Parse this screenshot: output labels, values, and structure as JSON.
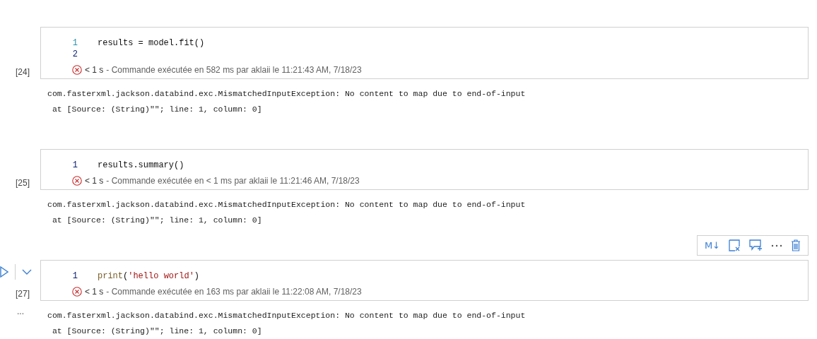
{
  "cells": [
    {
      "prompt": "[24]",
      "lines": [
        {
          "number": "1",
          "current": false,
          "tokens": [
            {
              "text": "results = model.fit()",
              "kind": "plain"
            }
          ]
        },
        {
          "number": "2",
          "current": true
        }
      ],
      "status": {
        "error": true,
        "duration": "< 1 s",
        "message": "- Commande exécutée en 582 ms par aklaii le 11:21:43 AM, 7/18/23"
      },
      "output": [
        "com.fasterxml.jackson.databind.exc.MismatchedInputException: No content to map due to end-of-input",
        " at [Source: (String)\"\"; line: 1, column: 0]"
      ]
    },
    {
      "prompt": "[25]",
      "lines": [
        {
          "number": "1",
          "current": true,
          "tokens": [
            {
              "text": "results.summary()",
              "kind": "plain"
            }
          ]
        }
      ],
      "status": {
        "error": true,
        "duration": "< 1 s",
        "message": "- Commande exécutée en < 1 ms par aklaii le 11:21:46 AM, 7/18/23"
      },
      "output": [
        "com.fasterxml.jackson.databind.exc.MismatchedInputException: No content to map due to end-of-input",
        " at [Source: (String)\"\"; line: 1, column: 0]"
      ]
    },
    {
      "prompt": "[27]",
      "more": "...",
      "toolbar": [
        {
          "kind": "markdown",
          "label": "M↓"
        },
        {
          "kind": "clear-output"
        },
        {
          "kind": "comment"
        },
        {
          "kind": "more"
        },
        {
          "kind": "delete"
        }
      ],
      "lines": [
        {
          "number": "1",
          "current": true,
          "tokens": [
            {
              "text": "print",
              "kind": "function"
            },
            {
              "text": "(",
              "kind": "plain"
            },
            {
              "text": "'hello world'",
              "kind": "string"
            },
            {
              "text": ")",
              "kind": "plain"
            }
          ]
        }
      ],
      "status": {
        "error": true,
        "duration": "< 1 s",
        "message": "- Commande exécutée en 163 ms par aklaii le 11:22:08 AM, 7/18/23"
      },
      "output": [
        "com.fasterxml.jackson.databind.exc.MismatchedInputException: No content to map due to end-of-input",
        " at [Source: (String)\"\"; line: 1, column: 0]"
      ]
    }
  ]
}
